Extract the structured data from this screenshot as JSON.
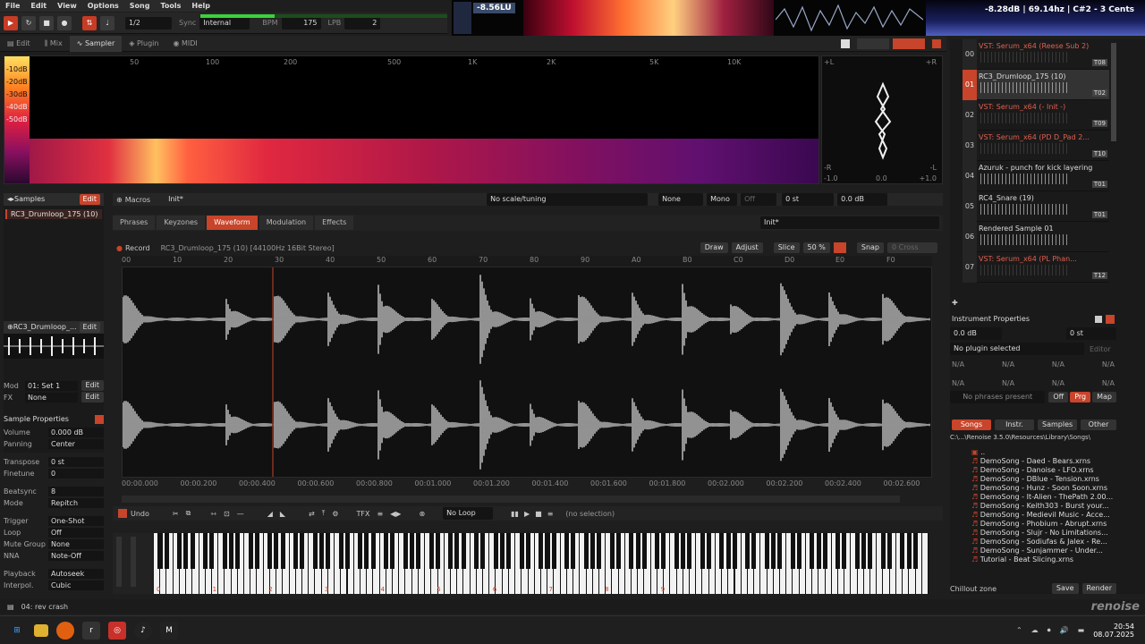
{
  "menu": [
    "File",
    "Edit",
    "View",
    "Options",
    "Song",
    "Tools",
    "Help"
  ],
  "transport": {
    "pattern_step": "1/2",
    "sync_label": "Sync",
    "sync_value": "Internal",
    "bpm_label": "BPM",
    "bpm": "175",
    "lpb_label": "LPB",
    "lpb": "2"
  },
  "scopes": {
    "loudness": "-8.56LU",
    "readout": "-8.28dB | 69.14hz | C#2 - 3 Cents"
  },
  "main_tabs": [
    "Edit",
    "Mix",
    "Sampler",
    "Plugin",
    "MIDI"
  ],
  "spectrum": {
    "db_labels": [
      "-10dB",
      "-20dB",
      "-30dB",
      "-40dB",
      "-50dB"
    ],
    "freq_labels": [
      "50",
      "100",
      "200",
      "500",
      "1K",
      "2K",
      "5K",
      "10K"
    ]
  },
  "scope_labels": {
    "tl": "+L",
    "tr": "+R",
    "bl": "-R",
    "br": "-L",
    "b1": "-1.0",
    "b2": "0.0",
    "b3": "+1.0"
  },
  "samples": {
    "header": "Samples",
    "edit": "Edit",
    "selected": "RC3_Drumloop_175 (10)"
  },
  "mini": {
    "name": "RC3_Drumloop_...",
    "edit": "Edit"
  },
  "modfx": {
    "mod_label": "Mod",
    "mod_value": "01: Set 1",
    "fx_label": "FX",
    "fx_value": "None",
    "edit": "Edit"
  },
  "sample_props": {
    "title": "Sample Properties",
    "rows": [
      {
        "label": "Volume",
        "value": "0.000 dB"
      },
      {
        "label": "Panning",
        "value": "Center"
      },
      {
        "label": "Transpose",
        "value": "0 st"
      },
      {
        "label": "Finetune",
        "value": "0"
      },
      {
        "label": "Beatsync",
        "value": "8"
      },
      {
        "label": "Mode",
        "value": "Repitch"
      },
      {
        "label": "Trigger",
        "value": "One-Shot"
      },
      {
        "label": "Loop",
        "value": "Off"
      },
      {
        "label": "Mute Group",
        "value": "None"
      },
      {
        "label": "NNA",
        "value": "Note-Off"
      },
      {
        "label": "Playback",
        "value": "Autoseek"
      },
      {
        "label": "Interpol.",
        "value": "Cubic"
      }
    ]
  },
  "macros": {
    "label": "Macros",
    "preset": "Init*",
    "tuning": "No scale/tuning",
    "none": "None",
    "mono": "Mono",
    "off": "Off",
    "st": "0 st",
    "db": "0.0 dB"
  },
  "subtabs": [
    "Phrases",
    "Keyzones",
    "Waveform",
    "Modulation",
    "Effects"
  ],
  "subtab_preset": "Init*",
  "wave": {
    "record": "Record",
    "title": "RC3_Drumloop_175 (10) [44100Hz 16Bit Stereo]",
    "draw": "Draw",
    "adjust": "Adjust",
    "slice": "Slice",
    "zoom": "50 %",
    "snap": "Snap",
    "cross": "0 Cross"
  },
  "ruler": [
    "00",
    "10",
    "20",
    "30",
    "40",
    "50",
    "60",
    "70",
    "80",
    "90",
    "A0",
    "B0",
    "C0",
    "D0",
    "E0",
    "F0"
  ],
  "timeline": [
    "00:00.000",
    "00:00.200",
    "00:00.400",
    "00:00.600",
    "00:00.800",
    "00:01.000",
    "00:01.200",
    "00:01.400",
    "00:01.600",
    "00:01.800",
    "00:02.000",
    "00:02.200",
    "00:02.400",
    "00:02.600"
  ],
  "wavetools": {
    "undo": "Undo",
    "loop": "No Loop",
    "selection": "(no selection)"
  },
  "octaves": [
    "0",
    "1",
    "2",
    "3",
    "4",
    "5",
    "6",
    "7",
    "8",
    "9"
  ],
  "instruments": [
    {
      "num": "00",
      "name": "VST: Serum_x64 (Reese Sub 2)",
      "tag": "T08",
      "sel": false
    },
    {
      "num": "01",
      "name": "RC3_Drumloop_175 (10)",
      "tag": "T02",
      "sel": true
    },
    {
      "num": "02",
      "name": "VST: Serum_x64 (- Init -)",
      "tag": "T09",
      "sel": false
    },
    {
      "num": "03",
      "name": "VST: Serum_x64 (PD D_Pad 2...",
      "tag": "T10",
      "sel": false
    },
    {
      "num": "04",
      "name": "Azuruk - punch for kick layering",
      "tag": "T01",
      "sel": false
    },
    {
      "num": "05",
      "name": "RC4_Snare (19)",
      "tag": "T01",
      "sel": false
    },
    {
      "num": "06",
      "name": "Rendered Sample 01",
      "tag": "",
      "sel": false
    },
    {
      "num": "07",
      "name": "VST: Serum_x64 (PL Phan...",
      "tag": "T12",
      "sel": false
    }
  ],
  "inst_props": {
    "title": "Instrument Properties",
    "db": "0.0 dB",
    "st": "0 st",
    "plugin": "No plugin selected",
    "editor": "Editor",
    "na": "N/A",
    "phrases": "No phrases present",
    "off": "Off",
    "prg": "Prg",
    "map": "Map"
  },
  "browser": {
    "tabs": [
      "Songs",
      "Instr.",
      "Samples",
      "Other"
    ],
    "path": "C:\\...\\Renoise 3.5.0\\Resources\\Library\\Songs\\",
    "files": [
      "..",
      "DemoSong - Daed - Bears.xrns",
      "DemoSong - Danoise - LFO.xrns",
      "DemoSong - DBlue - Tension.xrns",
      "DemoSong - Hunz - Soon Soon.xrns",
      "DemoSong - It-Alien - ThePath 2.00...",
      "DemoSong - Keith303 - Burst your...",
      "DemoSong - Medievil Music - Acce...",
      "DemoSong - Phobium - Abrupt.xrns",
      "DemoSong - Slujr - No Limitations...",
      "DemoSong - Sodiufas & Jalex - Re...",
      "DemoSong - Sunjammer - Under...",
      "Tutorial - Beat Slicing.xrns"
    ],
    "filename": "Chillout zone",
    "save": "Save",
    "render": "Render"
  },
  "status": {
    "track": "04: rev crash",
    "logo": "renoise"
  },
  "taskbar": {
    "time": "20:54",
    "date": "08.07.2025"
  },
  "colors": {
    "accent": "#c8442a",
    "bg": "#1e1e1e",
    "wave": "#e8e8e8"
  }
}
